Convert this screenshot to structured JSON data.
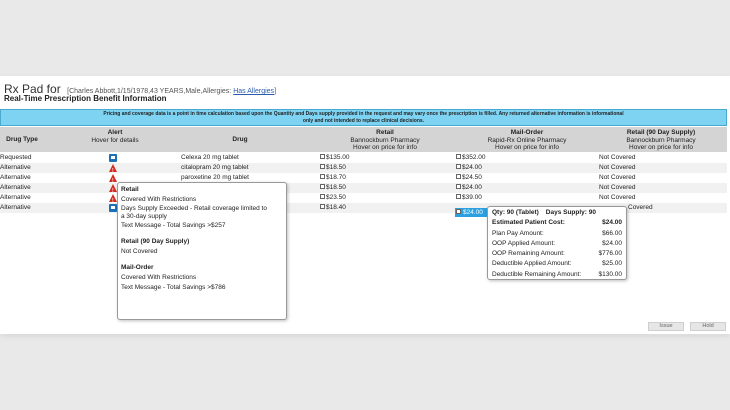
{
  "header": {
    "app_title": "Rx Pad for",
    "patient_info": "[Charles Abbott,1/15/1978,43 YEARS,Male,Allergies:",
    "allergies_link": "Has Allergies",
    "close_bracket": "]",
    "subtitle": "Real-Time Prescription Benefit Information"
  },
  "notice": {
    "line1": "Pricing and coverage data is a point in time calculation based upon the Quantity and Days supply provided in the request and may vary once the prescription is filled. Any returned alternative information is informational",
    "line2": "only and not intended to replace clinical decisions."
  },
  "columns": {
    "drug_type": "Drug Type",
    "alert": "Alert",
    "alert_sub": "Hover for details",
    "drug": "Drug",
    "retail": "Retail",
    "retail_pharmacy": "Bannockburn Pharmacy",
    "retail_sub": "Hover on price for info",
    "mail": "Mail-Order",
    "mail_pharmacy": "Rapid-Rx Online Pharmacy",
    "mail_sub": "Hover on price for info",
    "retail90": "Retail (90 Day Supply)",
    "retail90_pharmacy": "Bannockburn Pharmacy",
    "retail90_sub": "Hover on price for info"
  },
  "rows": [
    {
      "type": "Requested",
      "alert": "info",
      "drug": "Celexa 20 mg tablet",
      "retail": "$135.00",
      "mail": "$352.00",
      "retail90": "Not Covered"
    },
    {
      "type": "Alternative",
      "alert": "warning",
      "drug": "citalopram 20 mg tablet",
      "retail": "$18.50",
      "mail": "$24.00",
      "retail90": "Not Covered"
    },
    {
      "type": "Alternative",
      "alert": "warning",
      "drug": "paroxetine 20 mg tablet",
      "retail": "$18.70",
      "mail": "$24.50",
      "retail90": "Not Covered"
    },
    {
      "type": "Alternative",
      "alert": "warning",
      "drug": "",
      "retail": "$18.50",
      "mail": "$24.00",
      "retail90": "Not Covered"
    },
    {
      "type": "Alternative",
      "alert": "warning",
      "drug": "",
      "retail": "$23.50",
      "mail": "$39.00",
      "retail90": "Not Covered"
    },
    {
      "type": "Alternative",
      "alert": "info",
      "drug": "",
      "retail": "$18.40",
      "mail": "$24.00",
      "retail90": "Covered"
    }
  ],
  "alert_tooltip": {
    "retail_h": "Retail",
    "retail_1": "Covered With Restrictions",
    "retail_2": "Days Supply Exceeded - Retail coverage limited to",
    "retail_3": "a 30-day supply",
    "retail_4": "Text Message - Total Savings >$257",
    "retail90_h": "Retail (90 Day Supply)",
    "retail90_1": "Not Covered",
    "mail_h": "Mail-Order",
    "mail_1": "Covered With Restrictions",
    "mail_2": "Text Message - Total Savings >$786"
  },
  "price_tooltip": {
    "qty": "Qty: 90 (Tablet)",
    "days": "Days Supply: 90",
    "lines": [
      {
        "label": "Estimated Patient Cost:",
        "value": "$24.00",
        "bold": true
      },
      {
        "label": "Plan Pay Amount:",
        "value": "$66.00"
      },
      {
        "label": "OOP Applied Amount:",
        "value": "$24.00"
      },
      {
        "label": "OOP Remaining Amount:",
        "value": "$776.00"
      },
      {
        "label": "Deductible Applied Amount:",
        "value": "$25.00"
      },
      {
        "label": "Deductible Remaining Amount:",
        "value": "$130.00"
      }
    ]
  },
  "highlighted_price": "$24.00",
  "buttons": {
    "issue": "Issue",
    "hold": "Hold"
  }
}
